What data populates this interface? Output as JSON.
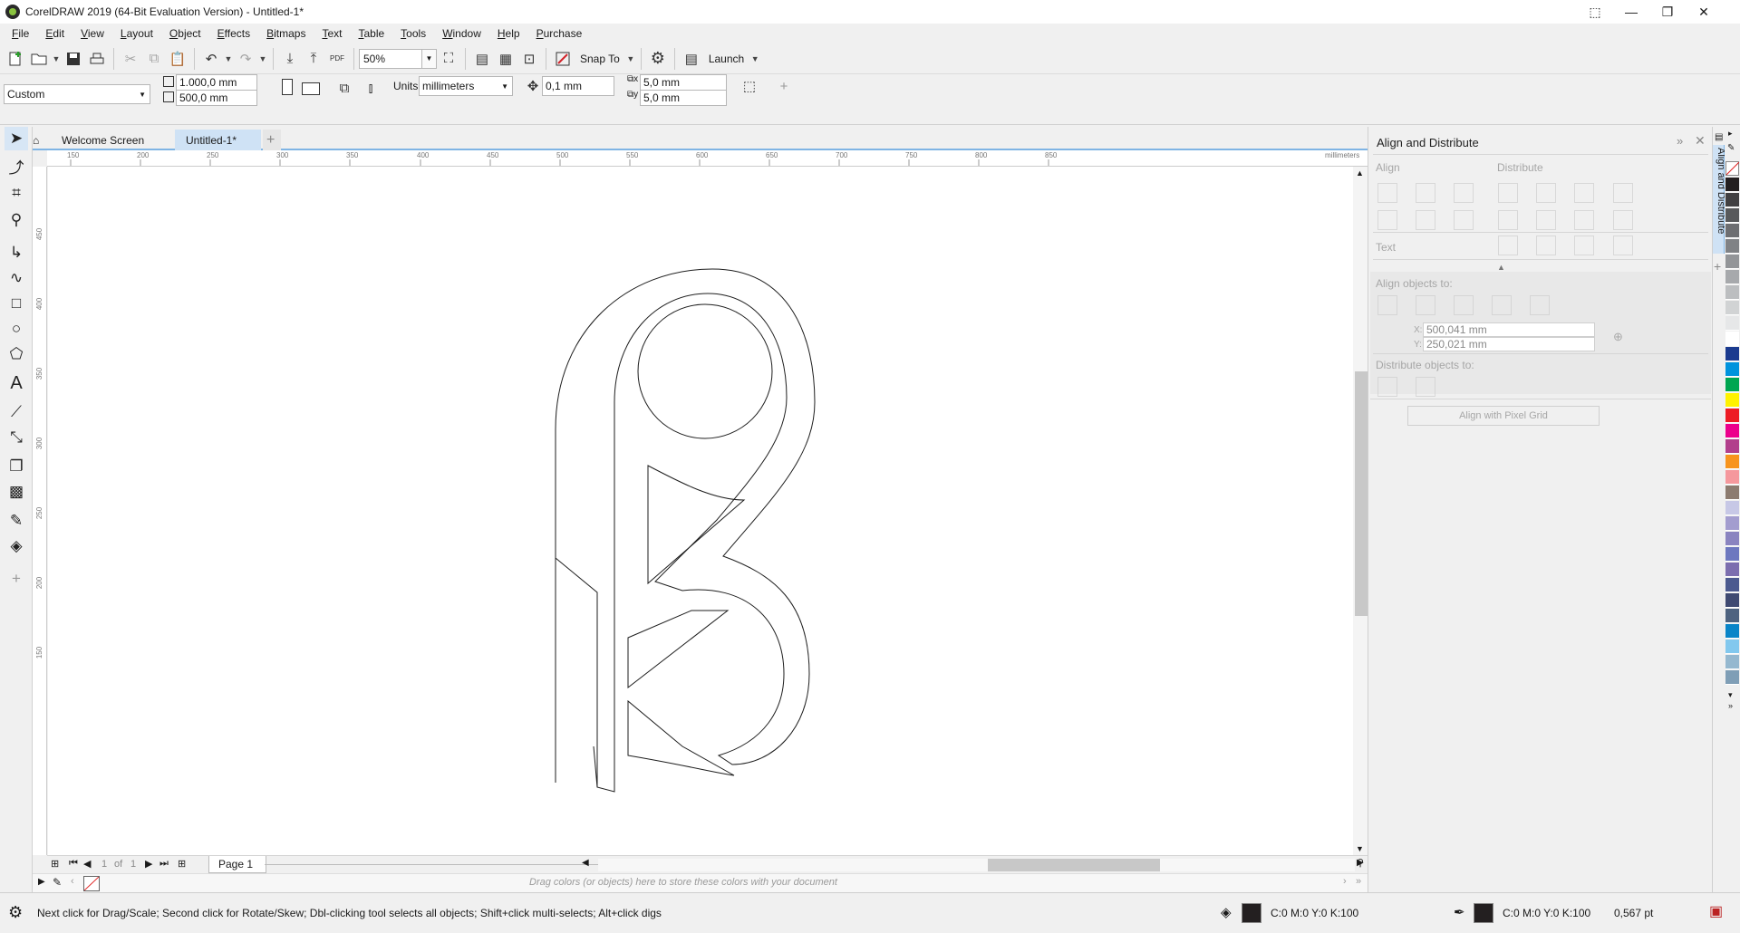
{
  "window": {
    "title": "CorelDRAW 2019 (64-Bit Evaluation Version) - Untitled-1*",
    "controls": [
      "⬚",
      "—",
      "❐",
      "✕"
    ]
  },
  "menu": [
    "File",
    "Edit",
    "View",
    "Layout",
    "Object",
    "Effects",
    "Bitmaps",
    "Text",
    "Table",
    "Tools",
    "Window",
    "Help",
    "Purchase"
  ],
  "toolbar": {
    "zoom": "50%",
    "snap_to": "Snap To",
    "launch": "Launch"
  },
  "property_bar": {
    "page_preset": "Custom",
    "width": "1.000,0 mm",
    "height": "500,0 mm",
    "units_label": "Units:",
    "units": "millimeters",
    "nudge": "0,1 mm",
    "dup_x": "5,0 mm",
    "dup_y": "5,0 mm"
  },
  "tabs": {
    "welcome": "Welcome Screen",
    "document": "Untitled-1*",
    "add": "+"
  },
  "ruler": {
    "h_ticks": [
      "150",
      "200",
      "250",
      "300",
      "350",
      "400",
      "450",
      "500",
      "550",
      "600",
      "650",
      "700",
      "750",
      "800",
      "850"
    ],
    "unit": "millimeters",
    "v_ticks": [
      "450",
      "400",
      "350",
      "300",
      "250",
      "200",
      "150"
    ]
  },
  "page_nav": {
    "current": "1",
    "of": "of",
    "total": "1",
    "page_tab": "Page 1"
  },
  "color_dock": {
    "hint": "Drag colors (or objects) here to store these colors with your document"
  },
  "status": {
    "hint": "Next click for Drag/Scale; Second click for Rotate/Skew; Dbl-clicking tool selects all objects; Shift+click multi-selects; Alt+click digs",
    "fill": "C:0 M:0 Y:0 K:100",
    "outline": "C:0 M:0 Y:0 K:100",
    "outline_width": "0,567 pt",
    "fill_color": "#231f20",
    "outline_color": "#231f20"
  },
  "docker": {
    "title": "Align and Distribute",
    "tab_label": "Align and Distribute",
    "align": "Align",
    "distribute": "Distribute",
    "text": "Text",
    "align_objects_to": "Align objects to:",
    "x_label": "X:",
    "x": "500,041 mm",
    "y_label": "Y:",
    "y": "250,021 mm",
    "distribute_objects_to": "Distribute objects to:",
    "pixel_grid": "Align with Pixel Grid"
  },
  "palette": [
    "#231f20",
    "#414042",
    "#58595b",
    "#6d6e71",
    "#808285",
    "#939598",
    "#a7a9ac",
    "#bcbec0",
    "#d1d3d4",
    "#e6e7e8",
    "#ffffff",
    "#1b3b8f",
    "#0093dd",
    "#00a651",
    "#fff200",
    "#ed1c24",
    "#ec008c",
    "#b23f8c",
    "#f7941d",
    "#f5989d",
    "#8c7b70",
    "#c7c8e6",
    "#a39dcf",
    "#8a84c0",
    "#6d78bf",
    "#7c6eaf",
    "#4c5a8f",
    "#3f4a72",
    "#4e6380",
    "#0a85c8",
    "#82c8ee",
    "#95b8cf",
    "#7f9eb6"
  ]
}
